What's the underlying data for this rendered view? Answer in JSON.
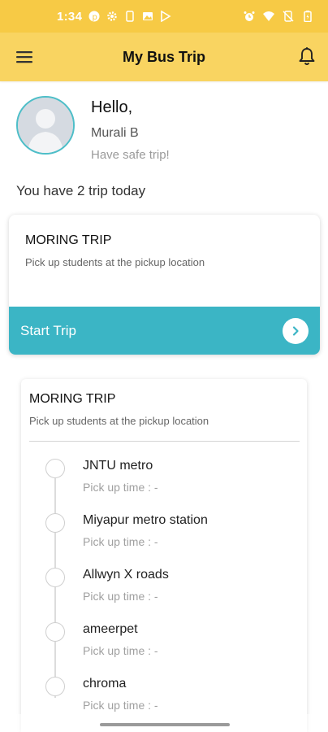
{
  "status_bar": {
    "time": "1:34",
    "icons": [
      "pinterest-icon",
      "gear-icon",
      "sim-icon",
      "image-icon",
      "play-store-icon",
      "alarm-icon",
      "wifi-icon",
      "no-sim-icon",
      "battery-icon"
    ]
  },
  "app_bar": {
    "title": "My Bus Trip",
    "menu_icon": "hamburger-menu-icon",
    "notification_icon": "bell-icon"
  },
  "profile": {
    "greeting": "Hello,",
    "name": "Murali B",
    "wish": "Have safe trip!"
  },
  "summary": "You have 2 trip today",
  "active_trip": {
    "title": "MORING TRIP",
    "subtitle": "Pick up students at the pickup location",
    "start_label": "Start Trip"
  },
  "route": {
    "title": "MORING TRIP",
    "subtitle": "Pick up students at the pickup location",
    "stops": [
      {
        "name": "JNTU metro",
        "pickup_time": "Pick up time : -"
      },
      {
        "name": "Miyapur metro station",
        "pickup_time": "Pick up time : -"
      },
      {
        "name": "Allwyn X roads",
        "pickup_time": "Pick up time : -"
      },
      {
        "name": "ameerpet",
        "pickup_time": "Pick up time : -"
      },
      {
        "name": "chroma",
        "pickup_time": "Pick up time : -"
      }
    ]
  },
  "colors": {
    "status_bar": "#f7ca45",
    "app_bar": "#f9d461",
    "accent": "#3bb5c5",
    "avatar_ring": "#4dbec8"
  }
}
